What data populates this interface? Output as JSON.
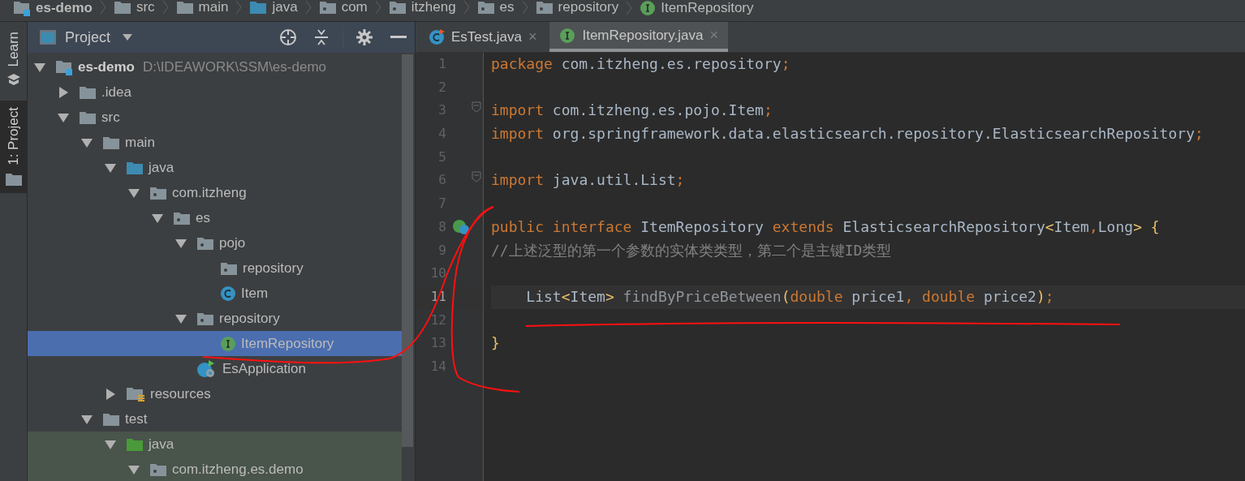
{
  "breadcrumb": [
    {
      "label": "es-demo",
      "kind": "module"
    },
    {
      "label": "src",
      "kind": "folder"
    },
    {
      "label": "main",
      "kind": "folder"
    },
    {
      "label": "java",
      "kind": "source"
    },
    {
      "label": "com",
      "kind": "package"
    },
    {
      "label": "itzheng",
      "kind": "package"
    },
    {
      "label": "es",
      "kind": "package"
    },
    {
      "label": "repository",
      "kind": "package"
    },
    {
      "label": "ItemRepository",
      "kind": "interface"
    }
  ],
  "side_tabs": [
    {
      "label": "Learn",
      "kind": "learn",
      "selected": false
    },
    {
      "label": "1: Project",
      "kind": "folder",
      "selected": true
    }
  ],
  "project_panel": {
    "title": "Project",
    "tree": [
      {
        "label": "es-demo",
        "path": "D:\\IDEAWORK\\SSM\\es-demo",
        "kind": "module",
        "expanded": true,
        "selected": false,
        "test_scope": false,
        "children": [
          {
            "label": ".idea",
            "kind": "folder",
            "expanded": false,
            "selected": false,
            "test_scope": false
          },
          {
            "label": "src",
            "kind": "folder",
            "expanded": true,
            "selected": false,
            "test_scope": false,
            "children": [
              {
                "label": "main",
                "kind": "folder",
                "expanded": true,
                "selected": false,
                "test_scope": false,
                "children": [
                  {
                    "label": "java",
                    "kind": "source",
                    "expanded": true,
                    "selected": false,
                    "test_scope": false,
                    "children": [
                      {
                        "label": "com.itzheng",
                        "kind": "package",
                        "expanded": true,
                        "selected": false,
                        "test_scope": false,
                        "children": [
                          {
                            "label": "es",
                            "kind": "package",
                            "expanded": true,
                            "selected": false,
                            "test_scope": false,
                            "children": [
                              {
                                "label": "pojo",
                                "kind": "package",
                                "expanded": true,
                                "selected": false,
                                "test_scope": false,
                                "children": [
                                  {
                                    "label": "repository",
                                    "kind": "package",
                                    "selected": false,
                                    "test_scope": false
                                  },
                                  {
                                    "label": "Item",
                                    "kind": "class",
                                    "selected": false,
                                    "test_scope": false
                                  }
                                ]
                              },
                              {
                                "label": "repository",
                                "kind": "package",
                                "expanded": true,
                                "selected": false,
                                "test_scope": false,
                                "children": [
                                  {
                                    "label": "ItemRepository",
                                    "kind": "interface",
                                    "selected": true,
                                    "test_scope": false
                                  }
                                ]
                              },
                              {
                                "label": "EsApplication",
                                "kind": "spring",
                                "selected": false,
                                "test_scope": false
                              }
                            ]
                          }
                        ]
                      }
                    ]
                  },
                  {
                    "label": "resources",
                    "kind": "resources",
                    "expanded": false,
                    "selected": false,
                    "test_scope": false
                  }
                ]
              },
              {
                "label": "test",
                "kind": "folder",
                "expanded": true,
                "selected": false,
                "test_scope": false,
                "children": [
                  {
                    "label": "java",
                    "kind": "test_source",
                    "expanded": true,
                    "selected": false,
                    "test_scope": true,
                    "children": [
                      {
                        "label": "com.itzheng.es.demo",
                        "kind": "package",
                        "expanded": true,
                        "selected": false,
                        "test_scope": true
                      }
                    ]
                  }
                ]
              }
            ]
          }
        ]
      }
    ]
  },
  "editor_tabs": [
    {
      "label": "EsTest.java",
      "kind": "class_run",
      "close": "×",
      "selected": false
    },
    {
      "label": "ItemRepository.java",
      "kind": "interface",
      "close": "×",
      "selected": true
    }
  ],
  "code_lines": [
    {
      "number": "1",
      "current": false,
      "kind": "plain",
      "tokens": [
        {
          "text": "package",
          "kind": "kw"
        },
        {
          "text": " com.itzheng.es.repository",
          "kind": "plain"
        },
        {
          "text": ";",
          "kind": "punct"
        }
      ]
    },
    {
      "number": "2",
      "current": false,
      "kind": "plain"
    },
    {
      "number": "3",
      "current": false,
      "kind": "fold",
      "tokens": [
        {
          "text": "import",
          "kind": "kw"
        },
        {
          "text": " com.itzheng.es.pojo.Item",
          "kind": "plain"
        },
        {
          "text": ";",
          "kind": "punct"
        }
      ]
    },
    {
      "number": "4",
      "current": false,
      "kind": "plain",
      "tokens": [
        {
          "text": "import",
          "kind": "kw"
        },
        {
          "text": " org.springframework.data.elasticsearch.repository.ElasticsearchRepository",
          "kind": "plain"
        },
        {
          "text": ";",
          "kind": "punct"
        }
      ]
    },
    {
      "number": "5",
      "current": false,
      "kind": "plain"
    },
    {
      "number": "6",
      "current": false,
      "kind": "fold",
      "tokens": [
        {
          "text": "import",
          "kind": "kw"
        },
        {
          "text": " java.util.List",
          "kind": "plain"
        },
        {
          "text": ";",
          "kind": "punct"
        }
      ]
    },
    {
      "number": "7",
      "current": false,
      "kind": "plain"
    },
    {
      "number": "8",
      "current": false,
      "kind": "implemented",
      "tokens": [
        {
          "text": "public interface",
          "kind": "kw"
        },
        {
          "text": " ItemRepository ",
          "kind": "plain"
        },
        {
          "text": "extends",
          "kind": "kw"
        },
        {
          "text": " ElasticsearchRepository",
          "kind": "plain"
        },
        {
          "text": "<",
          "kind": "brace"
        },
        {
          "text": "Item",
          "kind": "plain"
        },
        {
          "text": ",",
          "kind": "punct"
        },
        {
          "text": "Long",
          "kind": "plain"
        },
        {
          "text": "> {",
          "kind": "brace"
        }
      ]
    },
    {
      "number": "9",
      "current": false,
      "kind": "plain",
      "tokens": [
        {
          "text": "//上述泛型的第一个参数的实体类类型，第二个是主键ID类型",
          "kind": "comment"
        }
      ]
    },
    {
      "number": "10",
      "current": false,
      "kind": "plain"
    },
    {
      "number": "11",
      "current": true,
      "kind": "plain",
      "tokens": [
        {
          "text": "    List",
          "kind": "plain"
        },
        {
          "text": "<",
          "kind": "brace"
        },
        {
          "text": "Item",
          "kind": "plain"
        },
        {
          "text": ">",
          "kind": "brace"
        },
        {
          "text": " findByPriceBetween",
          "kind": "unused"
        },
        {
          "text": "(",
          "kind": "brace"
        },
        {
          "text": "double",
          "kind": "kw"
        },
        {
          "text": " price1",
          "kind": "plain"
        },
        {
          "text": ",",
          "kind": "punct"
        },
        {
          "text": " double",
          "kind": "kw"
        },
        {
          "text": " price2",
          "kind": "plain"
        },
        {
          "text": ")",
          "kind": "brace"
        },
        {
          "text": ";",
          "kind": "punct"
        }
      ]
    },
    {
      "number": "12",
      "current": false,
      "kind": "plain"
    },
    {
      "number": "13",
      "current": false,
      "kind": "plain",
      "tokens": [
        {
          "text": "}",
          "kind": "brace"
        }
      ]
    },
    {
      "number": "14",
      "current": false,
      "kind": "plain"
    }
  ]
}
